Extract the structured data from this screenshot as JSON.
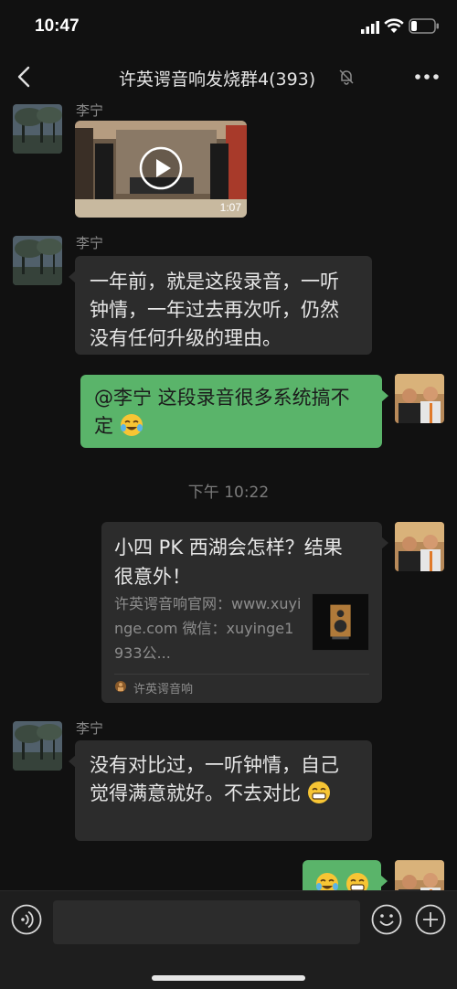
{
  "status_bar": {
    "time": "10:47"
  },
  "nav": {
    "title": "许英谔音响发烧群4(393)"
  },
  "messages": [
    {
      "sender": "李宁",
      "video_duration": "1:07"
    },
    {
      "sender": "李宁",
      "text": "一年前，就是这段录音，一听钟情，一年过去再次听，仍然没有任何升级的理由。"
    },
    {
      "text": "@李宁 这段录音很多系统搞不定"
    },
    {
      "timestamp": "下午 10:22"
    },
    {
      "card": {
        "title": "小四 PK 西湖会怎样？结果很意外！",
        "description": "许英谔音响官网：www.xuyinge.com  微信：xuyinge1933公...",
        "source": "许英谔音响"
      }
    },
    {
      "sender": "李宁",
      "text": "没有对比过，一听钟情，自己觉得满意就好。不去对比"
    }
  ],
  "colors": {
    "background": "#111111",
    "bubble_gray": "#2c2c2c",
    "bubble_green": "#5ab46a"
  },
  "icons": [
    "back-arrow-icon",
    "mute-bell-icon",
    "more-dots-icon",
    "play-icon",
    "voice-icon",
    "emoji-icon",
    "plus-icon"
  ]
}
